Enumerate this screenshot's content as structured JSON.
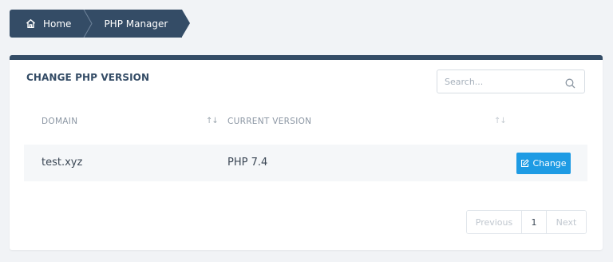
{
  "breadcrumb": {
    "home_label": "Home",
    "current_label": "PHP Manager"
  },
  "card": {
    "title": "CHANGE PHP VERSION",
    "search_placeholder": "Search...",
    "columns": {
      "domain": "DOMAIN",
      "current_version": "CURRENT VERSION",
      "sort_symbol": "↑↓"
    },
    "rows": [
      {
        "domain": "test.xyz",
        "version": "PHP 7.4",
        "action_label": "Change"
      }
    ],
    "pagination": {
      "previous_label": "Previous",
      "current_page": "1",
      "next_label": "Next"
    }
  },
  "colors": {
    "accent_dark": "#344c66",
    "button_blue": "#1e9be4",
    "page_background": "#f1f3f6"
  },
  "icons": {
    "home": "home-icon",
    "search": "search-icon",
    "edit": "edit-icon"
  }
}
